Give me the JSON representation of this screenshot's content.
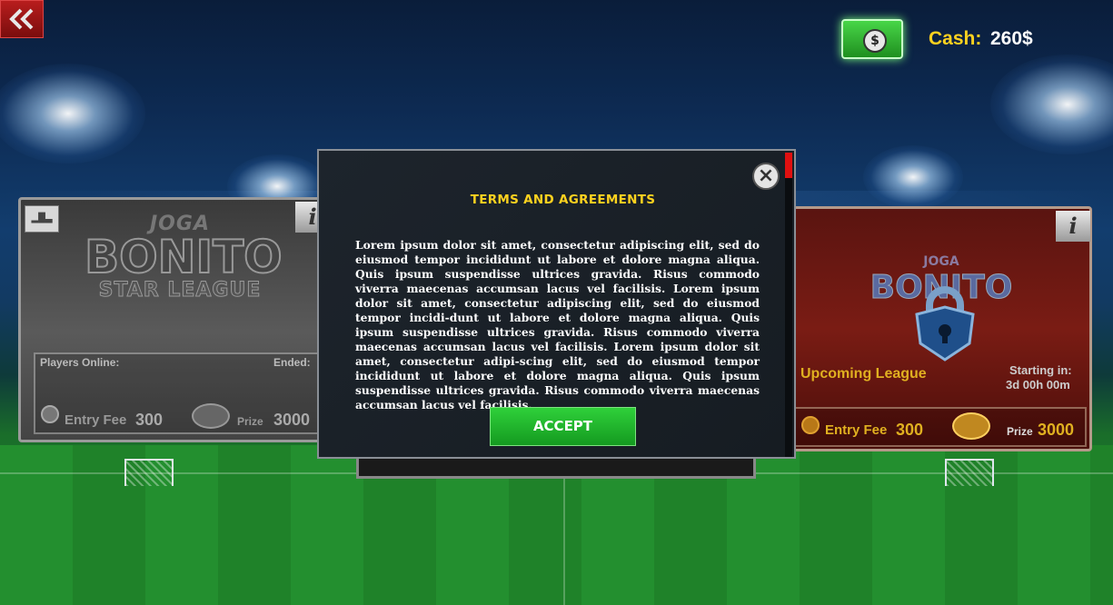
{
  "top_bar": {
    "back_icon": "double-chevron-left-icon",
    "cash_icon": "banknote-icon",
    "cash_symbol": "$",
    "cash_label": "Cash:",
    "cash_value": "260$"
  },
  "left_card": {
    "logo_line1": "JOGA",
    "logo_line2": "BONITO",
    "logo_line3": "STAR LEAGUE",
    "players_label": "Players Online:",
    "ended_label": "Ended:",
    "entry_fee_label": "Entry Fee",
    "entry_fee_value": "300",
    "prize_label": "Prize",
    "prize_value": "3000",
    "info_label": "i",
    "podium_icon": "podium-icon"
  },
  "right_card": {
    "logo_line1": "JOGA",
    "logo_line2": "BONITO",
    "status": "Upcoming League",
    "starting_label": "Starting in:",
    "starting_value": "3d 00h 00m",
    "entry_fee_label": "Entry Fee",
    "entry_fee_value": "300",
    "prize_label": "Prize",
    "prize_value": "3000",
    "info_label": "i",
    "lock_icon": "lock-icon"
  },
  "modal": {
    "title": "TERMS AND AGREEMENTS",
    "body": "Lorem ipsum dolor sit amet, consectetur adipiscing elit, sed do eiusmod tempor incididunt ut labore et dolore magna aliqua. Quis ipsum suspendisse ultrices gravida. Risus commodo viverra maecenas accumsan lacus vel facilisis. Lorem ipsum dolor sit amet, consectetur adipiscing elit, sed do eiusmod tempor incidi-dunt ut labore et dolore magna aliqua. Quis ipsum suspendisse ultrices gravida. Risus commodo viverra maecenas accumsan lacus vel facilisis. Lorem ipsum dolor sit amet, consectetur adipi-scing elit, sed do eiusmod tempor incididunt ut labore et dolore magna aliqua. Quis ipsum suspendisse ultrices gravida. Risus commodo viverra maecenas accumsan lacus vel facilisis.",
    "accept_label": "ACCEPT",
    "close_label": "×"
  },
  "colors": {
    "accent_yellow": "#ffd21f",
    "accept_green": "#1fb42b",
    "back_red": "#a01515"
  }
}
